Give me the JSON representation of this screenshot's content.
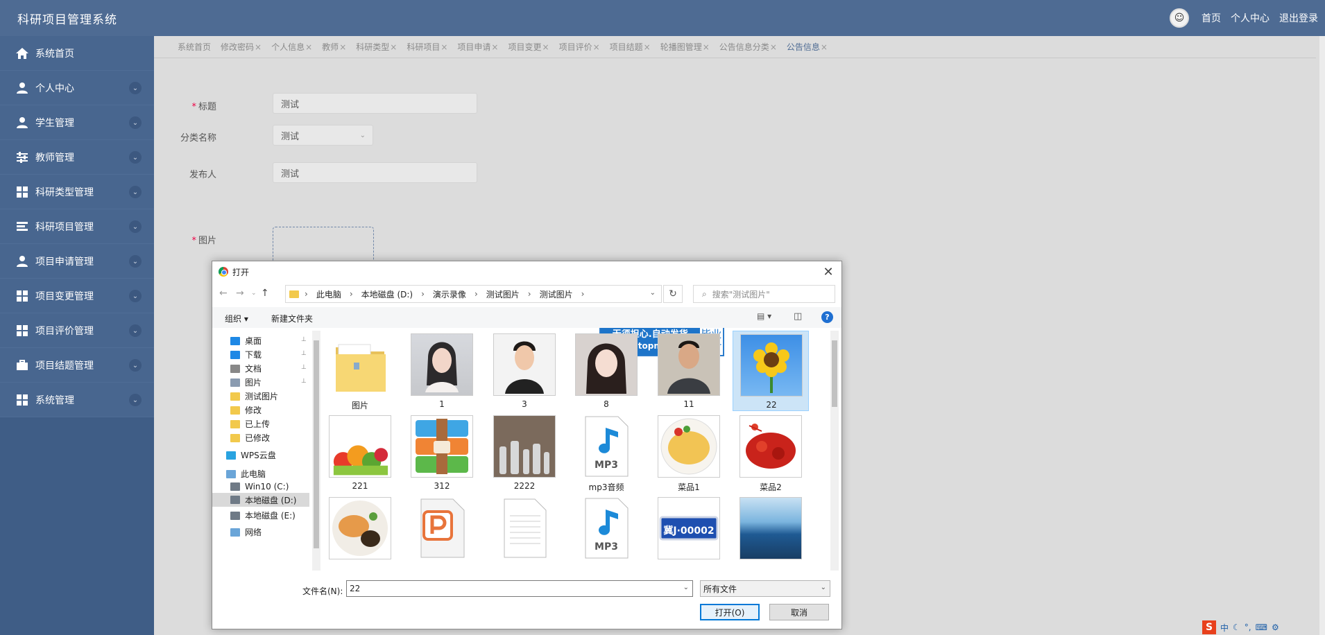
{
  "app": {
    "title": "科研项目管理系统"
  },
  "header": {
    "links": [
      "首页",
      "个人中心",
      "退出登录"
    ]
  },
  "sidebar": {
    "items": [
      {
        "label": "系统首页",
        "icon": "home-icon"
      },
      {
        "label": "个人中心",
        "icon": "user-icon"
      },
      {
        "label": "学生管理",
        "icon": "user-icon"
      },
      {
        "label": "教师管理",
        "icon": "sliders-icon"
      },
      {
        "label": "科研类型管理",
        "icon": "grid-icon"
      },
      {
        "label": "科研项目管理",
        "icon": "list-icon"
      },
      {
        "label": "项目申请管理",
        "icon": "user-icon"
      },
      {
        "label": "项目变更管理",
        "icon": "grid-icon"
      },
      {
        "label": "项目评价管理",
        "icon": "grid-icon"
      },
      {
        "label": "项目结题管理",
        "icon": "briefcase-icon"
      },
      {
        "label": "系统管理",
        "icon": "grid-icon"
      }
    ]
  },
  "tabs": [
    {
      "label": "系统首页",
      "closable": false
    },
    {
      "label": "修改密码",
      "closable": true
    },
    {
      "label": "个人信息",
      "closable": true
    },
    {
      "label": "教师",
      "closable": true
    },
    {
      "label": "科研类型",
      "closable": true
    },
    {
      "label": "科研项目",
      "closable": true
    },
    {
      "label": "项目申请",
      "closable": true
    },
    {
      "label": "项目变更",
      "closable": true
    },
    {
      "label": "项目评价",
      "closable": true
    },
    {
      "label": "项目结题",
      "closable": true
    },
    {
      "label": "轮播图管理",
      "closable": true
    },
    {
      "label": "公告信息分类",
      "closable": true
    },
    {
      "label": "公告信息",
      "closable": true
    }
  ],
  "tab_close": "×",
  "form": {
    "title_label": "标题",
    "title_value": "测试",
    "category_label": "分类名称",
    "category_value": "测试",
    "publisher_label": "发布人",
    "publisher_value": "测试",
    "image_label": "图片",
    "required_mark": "*"
  },
  "dialog": {
    "title": "打开",
    "close": "✕",
    "breadcrumb": [
      "此电脑",
      "本地磁盘 (D:)",
      "演示录像",
      "测试图片",
      "测试图片"
    ],
    "search_placeholder": "搜索\"测试图片\"",
    "toolbar": {
      "organize": "组织 ▾",
      "new_folder": "新建文件夹",
      "help": "?"
    },
    "watermark": {
      "line1": "无须担心.自动发货",
      "line2": "www.51topmind.com",
      "side1": "毕业",
      "side2": "设计"
    },
    "tree": [
      {
        "label": "桌面",
        "pinned": true
      },
      {
        "label": "下载",
        "pinned": true
      },
      {
        "label": "文档",
        "pinned": true
      },
      {
        "label": "图片",
        "pinned": true
      },
      {
        "label": "测试图片",
        "pinned": false
      },
      {
        "label": "修改",
        "pinned": false
      },
      {
        "label": "已上传",
        "pinned": false
      },
      {
        "label": "已修改",
        "pinned": false
      },
      {
        "label": "WPS云盘",
        "pinned": false
      },
      {
        "label": "此电脑",
        "pinned": false
      },
      {
        "label": "Win10 (C:)",
        "pinned": false
      },
      {
        "label": "本地磁盘 (D:)",
        "pinned": false
      },
      {
        "label": "本地磁盘 (E:)",
        "pinned": false
      },
      {
        "label": "网络",
        "pinned": false
      }
    ],
    "files": [
      {
        "name": "图片",
        "kind": "folder"
      },
      {
        "name": "1",
        "kind": "portrait-woman"
      },
      {
        "name": "3",
        "kind": "portrait-man"
      },
      {
        "name": "8",
        "kind": "portrait-woman2"
      },
      {
        "name": "11",
        "kind": "portrait-man2"
      },
      {
        "name": "22",
        "kind": "sunflower",
        "selected": true
      },
      {
        "name": "221",
        "kind": "vegetables"
      },
      {
        "name": "312",
        "kind": "archive"
      },
      {
        "name": "2222",
        "kind": "bottles"
      },
      {
        "name": "mp3音频",
        "kind": "mp3"
      },
      {
        "name": "菜品1",
        "kind": "dish"
      },
      {
        "name": "菜品2",
        "kind": "crayfish"
      },
      {
        "name": "",
        "kind": "shrimp"
      },
      {
        "name": "",
        "kind": "ppt"
      },
      {
        "name": "",
        "kind": "document"
      },
      {
        "name": "",
        "kind": "mp3"
      },
      {
        "name": "",
        "kind": "plate"
      },
      {
        "name": "",
        "kind": "sea"
      }
    ],
    "mp3_label": "MP3",
    "plate_text": "冀J·00002",
    "filename_label": "文件名(N):",
    "filename_value": "22",
    "filetype_value": "所有文件",
    "open_button": "打开(O)",
    "cancel_button": "取消"
  },
  "ime": {
    "brand": "S",
    "lang": "中"
  }
}
